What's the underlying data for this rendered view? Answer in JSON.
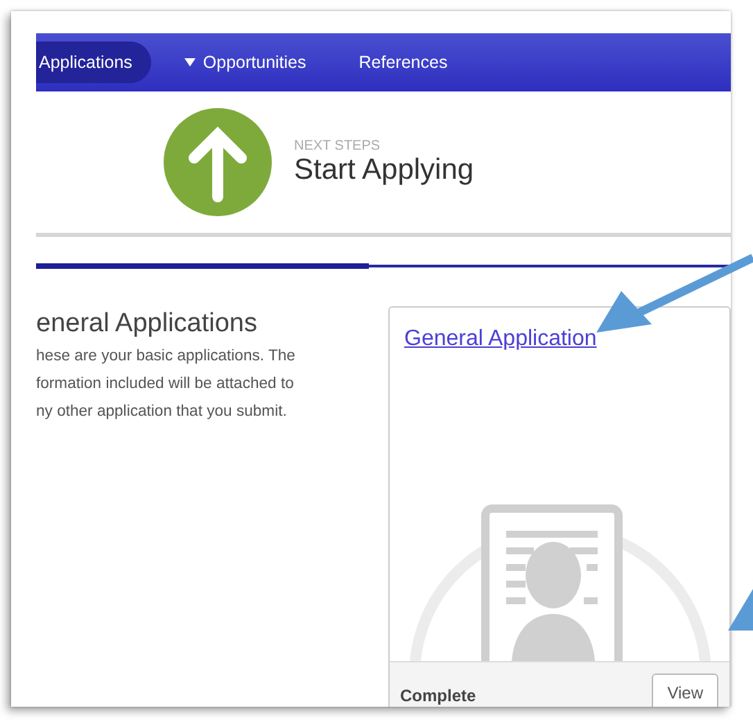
{
  "nav": {
    "tabs": [
      {
        "label": "Applications",
        "selected": true,
        "kind": "link"
      },
      {
        "label": "Opportunities",
        "selected": false,
        "kind": "dropdown"
      },
      {
        "label": "References",
        "selected": false,
        "kind": "link"
      }
    ]
  },
  "header": {
    "eyebrow": "NEXT STEPS",
    "title": "Start Applying"
  },
  "progress": {
    "level": 0.48
  },
  "section": {
    "heading": "eneral Applications",
    "description": [
      "hese are your basic applications. The",
      "formation included will be attached to",
      "ny other application that you submit."
    ]
  },
  "card": {
    "link": "General Application",
    "status": "Complete",
    "button": "View"
  }
}
